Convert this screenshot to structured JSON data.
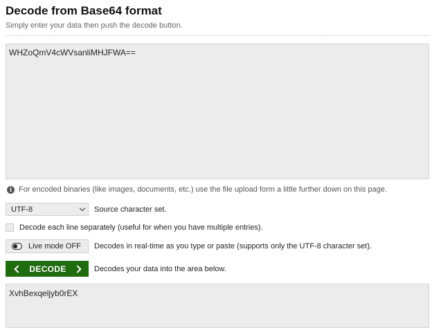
{
  "header": {
    "title": "Decode from Base64 format",
    "subtitle": "Simply enter your data then push the decode button."
  },
  "input": {
    "value": "WHZoQmV4cWVsanliMHJFWA=="
  },
  "info": {
    "icon": "info-icon",
    "text": "For encoded binaries (like images, documents, etc.) use the file upload form a little further down on this page."
  },
  "options": {
    "charset": {
      "selected": "UTF-8",
      "label": "Source character set."
    },
    "separate_lines": {
      "checked": false,
      "label": "Decode each line separately (useful for when you have multiple entries)."
    },
    "live_mode": {
      "button_label": "Live mode OFF",
      "description": "Decodes in real-time as you type or paste (supports only the UTF-8 character set)."
    },
    "decode": {
      "button_label": "DECODE",
      "description": "Decodes your data into the area below."
    }
  },
  "output": {
    "value": "XvhBexqeljyb0rEX"
  },
  "colors": {
    "accent": "#1f6b0f",
    "field_background": "#ececec"
  }
}
